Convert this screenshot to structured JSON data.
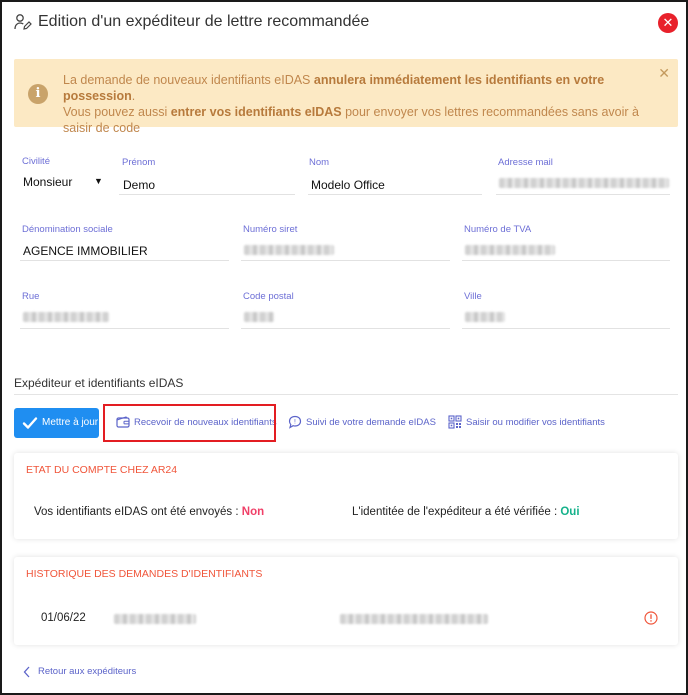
{
  "modal": {
    "title": "Edition d'un expéditeur de lettre recommandée"
  },
  "alert": {
    "line1_part1": "La demande de nouveaux identifiants eIDAS ",
    "line1_bold": "annulera immédiatement les identifiants en votre possession",
    "line1_end": ".",
    "line2_part1": "Vous pouvez aussi ",
    "line2_bold": "entrer vos identifiants eIDAS",
    "line2_part2": " pour envoyer vos lettres recommandées sans avoir à saisir de code",
    "close_glyph": "✕",
    "info_glyph": "i"
  },
  "form": {
    "civilite": {
      "label": "Civilité",
      "value": "Monsieur"
    },
    "prenom": {
      "label": "Prénom",
      "value": "Demo"
    },
    "nom": {
      "label": "Nom",
      "value": "Modelo Office"
    },
    "email": {
      "label": "Adresse mail"
    },
    "denomination": {
      "label": "Dénomination sociale",
      "value": "AGENCE IMMOBILIER"
    },
    "siret": {
      "label": "Numéro siret"
    },
    "tva": {
      "label": "Numéro de TVA"
    },
    "rue": {
      "label": "Rue"
    },
    "code_postal": {
      "label": "Code postal"
    },
    "ville": {
      "label": "Ville"
    }
  },
  "eidas": {
    "section_title": "Expéditeur et identifiants eIDAS",
    "update_button": "Mettre à jour",
    "tabs": [
      {
        "label": "Recevoir de nouveaux identifiants",
        "icon": "wallet-icon"
      },
      {
        "label": "Suivi de votre demande eIDAS",
        "icon": "chat-bubble-icon"
      },
      {
        "label": "Saisir ou modifier vos identifiants",
        "icon": "qr-code-icon"
      }
    ]
  },
  "account_status": {
    "title": "ETAT DU COMPTE CHEZ AR24",
    "sent_label": "Vos identifiants eIDAS ont été envoyés : ",
    "sent_value": "Non",
    "verified_label": "L'identitée de l'expéditeur a été vérifiée : ",
    "verified_value": "Oui"
  },
  "history": {
    "title": "HISTORIQUE DES DEMANDES D'IDENTIFIANTS",
    "rows": [
      {
        "date": "01/06/22"
      }
    ]
  },
  "back_link": "Retour aux expéditeurs",
  "colors": {
    "accent": "#1f8ef1",
    "link": "#5b63c9",
    "label": "#6d6fd6",
    "card_title": "#f0553a",
    "no": "#f04068",
    "yes": "#16b28b",
    "alert_bg": "#fce9c4",
    "close_red": "#e8212b",
    "highlight": "#e31d22"
  }
}
